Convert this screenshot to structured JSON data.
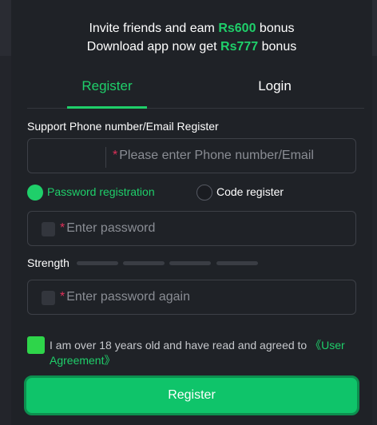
{
  "promo": {
    "line1_prefix": "Invite friends and eam ",
    "line1_amount": "Rs600",
    "line1_suffix": " bonus",
    "line2_prefix": "Download app now get ",
    "line2_amount": "Rs777",
    "line2_suffix": " bonus"
  },
  "tabs": [
    {
      "label": "Register",
      "active": true
    },
    {
      "label": "Login",
      "active": false
    }
  ],
  "form": {
    "section_label": "Support Phone number/Email Register",
    "required_mark": "*",
    "phone_placeholder": "Please enter Phone number/Email",
    "radio_password": "Password registration",
    "radio_code": "Code register",
    "password_placeholder": "Enter password",
    "strength_label": "Strength",
    "strength_level": 0,
    "password_again_placeholder": "Enter password again",
    "agree_checked": true,
    "agree_text": "I am over 18 years old and have read and agreed to ",
    "agree_link": "《User Agreement》",
    "submit_label": "Register"
  },
  "colors": {
    "accent": "#1fcf6a",
    "required": "#e0305a",
    "background": "#1f2227"
  }
}
